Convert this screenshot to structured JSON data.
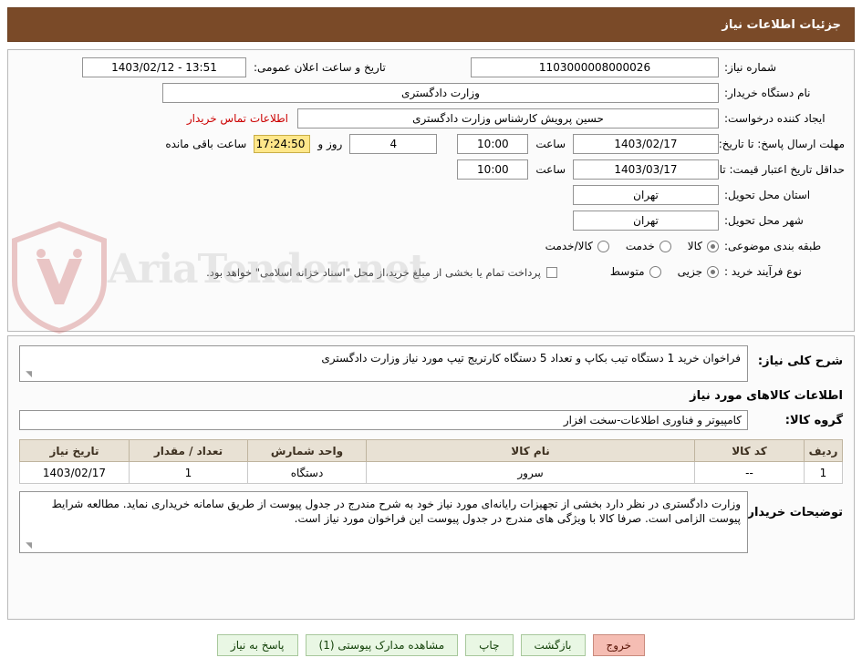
{
  "header": {
    "title": "جزئیات اطلاعات نیاز"
  },
  "form": {
    "need_number_label": "شماره نیاز:",
    "need_number_value": "1103000008000026",
    "announce_datetime_label": "تاریخ و ساعت اعلان عمومی:",
    "announce_datetime_value": "13:51 - 1403/02/12",
    "buyer_org_label": "نام دستگاه خریدار:",
    "buyer_org_value": "وزارت دادگستری",
    "creator_label": "ایجاد کننده درخواست:",
    "creator_value": "حسین پرویش کارشناس وزارت دادگستری",
    "contact_link": "اطلاعات تماس خریدار",
    "response_deadline_label": "مهلت ارسال پاسخ: تا تاریخ:",
    "response_deadline_date": "1403/02/17",
    "hour_label": "ساعت",
    "response_deadline_time": "10:00",
    "remaining_days": "4",
    "remaining_days_label": "روز و",
    "remaining_timer": "17:24:50",
    "remaining_suffix": "ساعت باقی مانده",
    "price_validity_label": "حداقل تاریخ اعتبار قیمت: تا تاریخ:",
    "price_validity_date": "1403/03/17",
    "price_validity_time": "10:00",
    "province_label": "استان محل تحویل:",
    "province_value": "تهران",
    "city_label": "شهر محل تحویل:",
    "city_value": "تهران",
    "category_label": "طبقه بندی موضوعی:",
    "category_options": [
      {
        "label": "کالا",
        "checked": true
      },
      {
        "label": "خدمت",
        "checked": false
      },
      {
        "label": "کالا/خدمت",
        "checked": false
      }
    ],
    "process_label": "نوع فرآیند خرید :",
    "process_options": [
      {
        "label": "جزیی",
        "checked": true
      },
      {
        "label": "متوسط",
        "checked": false
      }
    ],
    "payment_note": "پرداخت تمام یا بخشی از مبلغ خرید،از محل \"اسناد خزانه اسلامی\" خواهد بود."
  },
  "description": {
    "summary_label": "شرح کلی نیاز:",
    "summary_value": "فراخوان خرید 1 دستگاه تیب بکاپ و تعداد 5 دستگاه کارتریج تیپ مورد نیاز وزارت دادگستری",
    "items_title": "اطلاعات کالاهای مورد نیاز",
    "group_label": "گروه کالا:",
    "group_value": "کامپیوتر و فناوری اطلاعات-سخت افزار"
  },
  "table": {
    "headers": [
      "ردیف",
      "کد کالا",
      "نام کالا",
      "واحد شمارش",
      "تعداد / مقدار",
      "تاریخ نیاز"
    ],
    "rows": [
      [
        "1",
        "--",
        "سرور",
        "دستگاه",
        "1",
        "1403/02/17"
      ]
    ]
  },
  "buyer_notes": {
    "label": "توضیحات خریدار:",
    "value": "وزارت دادگستری در نظر دارد بخشی از تجهیزات رایانه‌ای مورد نیاز خود به شرح مندرج در جدول پیوست از طریق سامانه خریداری نماید. مطالعه شرایط پیوست الزامی است. صرفا کالا با ویژگی های مندرج در جدول پیوست این فراخوان مورد نیاز است."
  },
  "footer": {
    "buttons": [
      {
        "label": "پاسخ به نیاز",
        "style": "green"
      },
      {
        "label": "مشاهده مدارک پیوستی (1)",
        "style": "green"
      },
      {
        "label": "چاپ",
        "style": "green"
      },
      {
        "label": "بازگشت",
        "style": "green"
      },
      {
        "label": "خروج",
        "style": "red"
      }
    ]
  },
  "watermark": {
    "text": "AriaTender.net"
  }
}
